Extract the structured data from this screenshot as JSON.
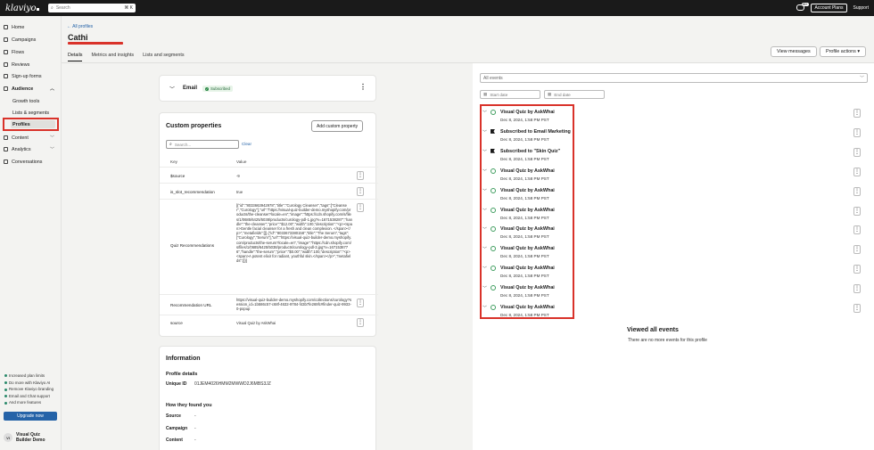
{
  "topbar": {
    "logo": "klaviyo",
    "search_placeholder": "Search",
    "search_shortcut": "⌘ K",
    "chat_badge": "99+",
    "account_plans": "Account Plans",
    "support": "Support"
  },
  "sidebar": {
    "items": [
      {
        "label": "Home",
        "icon": "home-icon"
      },
      {
        "label": "Campaigns",
        "icon": "campaigns-icon"
      },
      {
        "label": "Flows",
        "icon": "flows-icon"
      },
      {
        "label": "Reviews",
        "icon": "star-icon"
      },
      {
        "label": "Sign-up forms",
        "icon": "forms-icon"
      },
      {
        "label": "Audience",
        "icon": "audience-icon"
      },
      {
        "label": "Growth tools"
      },
      {
        "label": "Lists & segments"
      },
      {
        "label": "Profiles"
      },
      {
        "label": "Content",
        "icon": "content-icon"
      },
      {
        "label": "Analytics",
        "icon": "analytics-icon"
      },
      {
        "label": "Conversations",
        "icon": "conversations-icon"
      }
    ],
    "upsell": [
      "Increased plan limits",
      "Do more with Klaviyo AI",
      "Remove Klaviyo branding",
      "Email and Chat support",
      "And more features"
    ],
    "upgrade_label": "Upgrade now",
    "account_initials": "VI",
    "account_name_1": "Visual Quiz",
    "account_name_2": "Builder Demo"
  },
  "header": {
    "back": "← All profiles",
    "title": "Cathi",
    "tabs": [
      "Details",
      "Metrics and insights",
      "Lists and segments"
    ],
    "view_messages": "View messages",
    "profile_actions": "Profile actions ▾"
  },
  "email_card": {
    "label": "Email",
    "status": "Subscribed"
  },
  "custom_properties": {
    "title": "Custom properties",
    "add_button": "Add custom property",
    "search_placeholder": "Search...",
    "clear": "Clear",
    "col_key": "Key",
    "col_value": "Value",
    "rows": [
      {
        "key": "$source",
        "value": "-9"
      },
      {
        "key": "is_slot_recommendation",
        "value": "true"
      },
      {
        "key": "Quiz Recommendations",
        "value": "[{\"id\":\"8033663942978\",\"title\":\"Curology Cleanser\",\"tags\":[\"Cleanser\",\"Curology\"],\"url\":\"https://visual-quiz-builder-demo.myshopify.com/products/the-cleanser?locale=en\",\"image\":\"https://cdn.shopify.com/s/files/1/0685/6425/5038/products/curology-pdl-1.jpg?v=1671538287\",\"handle\":\"the-cleanser\",\"price\":\"$12.00\",\"width\":100,\"description\":\"<p><span>Gentle facial cleanser for a fresh and clean complexion. </span></p>\",\"metafields\":[]},{\"id\":\"8033673380158\",\"title\":\"The Serum\",\"tags\":[\"Curology\",\"Serum\"],\"url\":\"https://visual-quiz-builder-demo.myshopify.com/products/the-serum?locale=en\",\"image\":\"https://cdn.shopify.com/s/files/1/0685/6425/5038/products/curology-pdl-3.jpg?v=1671538776\",\"handle\":\"the-serum\",\"price\":\"$0.00\",\"width\":100,\"description\":\"<p><span>A potent elixir for radiant, youthful skin.</span></p>\",\"metafields\":[]}]"
      },
      {
        "key": "Recommendation URL",
        "value": "https://visual-quiz-builder-demo.myshopify.com/collections/curology?session_id=1b586c57-c68f-4632-9784-f43b7fe269fc#finder-quiz-9933-0-popup"
      },
      {
        "key": "source",
        "value": "Visual Quiz by AskWhai"
      }
    ]
  },
  "information": {
    "title": "Information",
    "profile_details": "Profile details",
    "unique_id_label": "Unique ID",
    "unique_id": "01JEM4026HMM2MWWD2J6MBS3JZ",
    "how_found": "How they found you",
    "source_label": "Source",
    "campaign_label": "Campaign",
    "content_label": "Content",
    "dash": "-"
  },
  "events": {
    "filter": "All events",
    "start_placeholder": "Start date",
    "end_placeholder": "End date",
    "items": [
      {
        "title": "Visual Quiz by AskWhai",
        "date": "Dec 8, 2024, 1:58 PM PST",
        "type": "quiz"
      },
      {
        "title": "Subscribed to Email Marketing",
        "date": "Dec 8, 2024, 1:58 PM PST",
        "type": "flag"
      },
      {
        "title": "Subscribed to \"Skin Quiz\"",
        "date": "Dec 8, 2024, 1:58 PM PST",
        "type": "flag"
      },
      {
        "title": "Visual Quiz by AskWhai",
        "date": "Dec 8, 2024, 1:58 PM PST",
        "type": "quiz"
      },
      {
        "title": "Visual Quiz by AskWhai",
        "date": "Dec 8, 2024, 1:58 PM PST",
        "type": "quiz"
      },
      {
        "title": "Visual Quiz by AskWhai",
        "date": "Dec 8, 2024, 1:58 PM PST",
        "type": "quiz"
      },
      {
        "title": "Visual Quiz by AskWhai",
        "date": "Dec 8, 2024, 1:58 PM PST",
        "type": "quiz"
      },
      {
        "title": "Visual Quiz by AskWhai",
        "date": "Dec 8, 2024, 1:58 PM PST",
        "type": "quiz"
      },
      {
        "title": "Visual Quiz by AskWhai",
        "date": "Dec 8, 2024, 1:58 PM PST",
        "type": "quiz"
      },
      {
        "title": "Visual Quiz by AskWhai",
        "date": "Dec 8, 2024, 1:58 PM PST",
        "type": "quiz"
      },
      {
        "title": "Visual Quiz by AskWhai",
        "date": "Dec 8, 2024, 1:58 PM PST",
        "type": "quiz"
      }
    ],
    "viewed_all": "Viewed all events",
    "no_more": "There are no more events for this profile"
  },
  "colors": {
    "highlight": "#d9322a",
    "brand_blue": "#2563a8",
    "dark": "#1a1a1a"
  }
}
